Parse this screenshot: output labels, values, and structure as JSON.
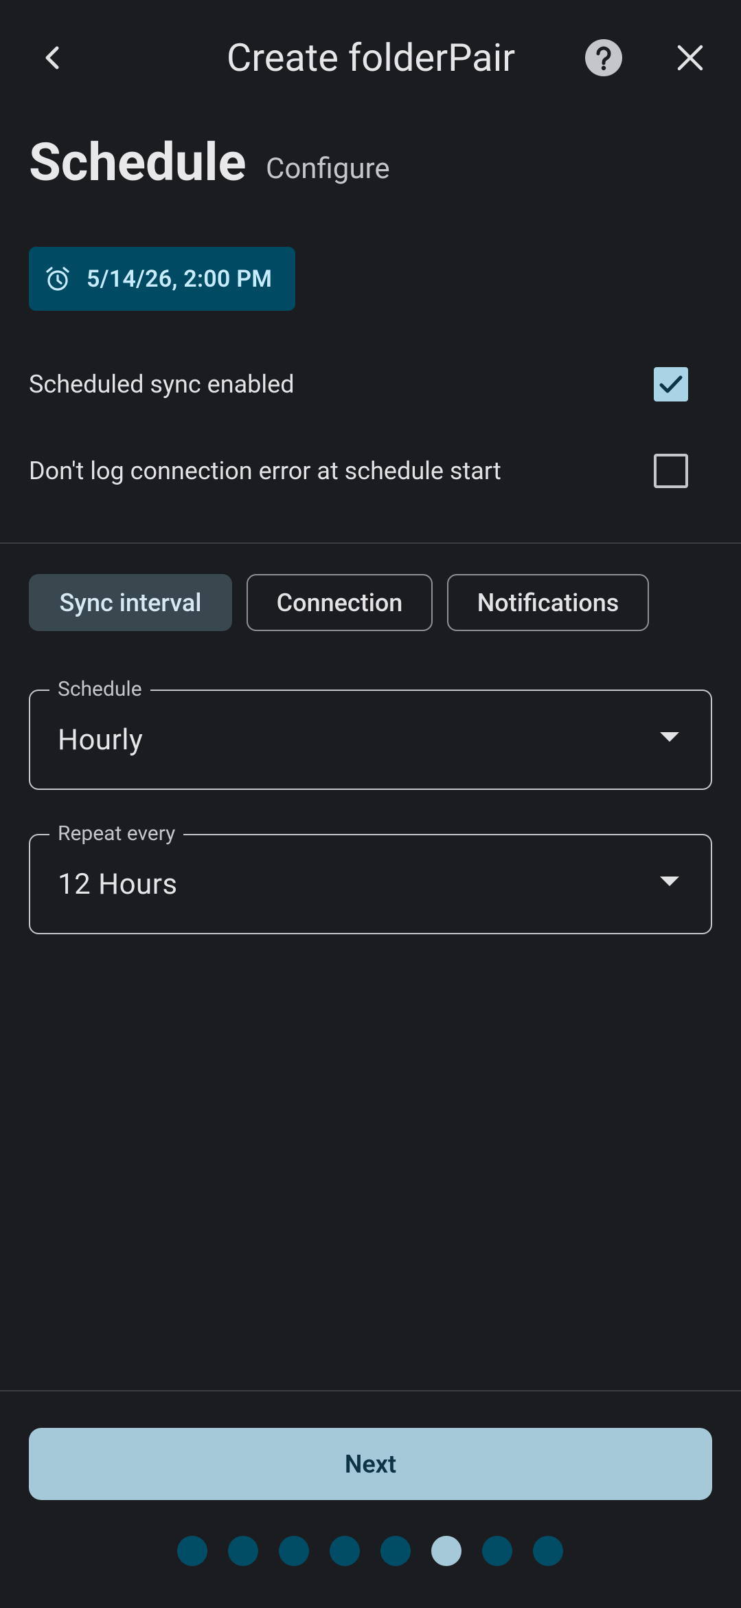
{
  "app_bar": {
    "title": "Create folderPair",
    "back_icon": "chevron-left-icon",
    "help_icon": "help-circle-icon",
    "close_icon": "close-icon"
  },
  "header": {
    "title": "Schedule",
    "subtitle": "Configure"
  },
  "date_chip": {
    "icon": "alarm-clock-icon",
    "label": "5/14/26, 2:00 PM"
  },
  "options": [
    {
      "label": "Scheduled sync enabled",
      "checked": true
    },
    {
      "label": "Don't log connection error at schedule start",
      "checked": false
    }
  ],
  "tabs": [
    {
      "label": "Sync interval",
      "selected": true
    },
    {
      "label": "Connection",
      "selected": false
    },
    {
      "label": "Notifications",
      "selected": false
    }
  ],
  "fields": {
    "schedule": {
      "label": "Schedule",
      "value": "Hourly"
    },
    "repeat": {
      "label": "Repeat every",
      "value": "12 Hours"
    }
  },
  "footer": {
    "next_label": "Next",
    "steps_total": 8,
    "current_step": 6
  },
  "colors": {
    "background": "#1a1c1f",
    "chip_bg": "#004a63",
    "accent": "#a5c9d9",
    "dot_inactive": "#014d66"
  }
}
